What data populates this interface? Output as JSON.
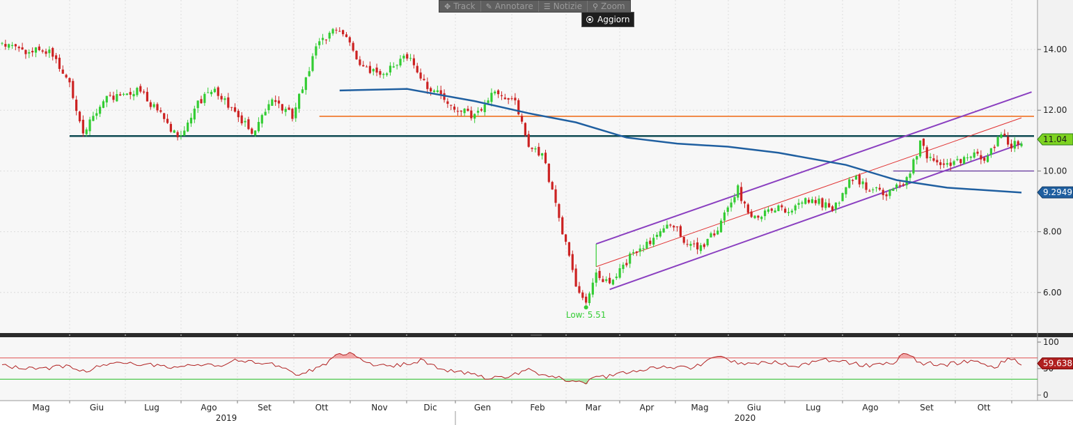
{
  "toolbar": {
    "items": [
      {
        "label": "Track",
        "icon": "crosshair-icon"
      },
      {
        "label": "Annotare",
        "icon": "pencil-icon"
      },
      {
        "label": "Notizie",
        "icon": "news-icon"
      },
      {
        "label": "Zoom",
        "icon": "magnifier-icon"
      }
    ],
    "update_label": "Aggiorn"
  },
  "colors": {
    "up": "#33cc33",
    "down": "#cc2222",
    "ma": "#1f5fa0",
    "channel": "#8a3fc0",
    "midline": "#e03030",
    "resistance": "#f07020",
    "support": "#0d4a52",
    "level10": "#6a3fa0",
    "rsi_line": "#b02020",
    "rsi_upper": "#e05050",
    "rsi_lower": "#22bb22"
  },
  "chart_data": [
    {
      "type": "candlestick",
      "title": "",
      "y_ticks": [
        "14.00",
        "12.00",
        "10.00",
        "8.00",
        "6.00"
      ],
      "ylim": [
        4.6,
        15.7
      ],
      "grid": true,
      "x_months": [
        "Mag",
        "Giu",
        "Lug",
        "Ago",
        "Set",
        "Ott",
        "Nov",
        "Dic",
        "Gen",
        "Feb",
        "Mar",
        "Apr",
        "Mag",
        "Giu",
        "Lug",
        "Ago",
        "Set",
        "Ott"
      ],
      "x_years": [
        "2019",
        "2020"
      ],
      "close_path": [
        [
          0,
          14.2
        ],
        [
          8,
          13.9
        ],
        [
          14,
          14.0
        ],
        [
          20,
          12.9
        ],
        [
          24,
          11.3
        ],
        [
          30,
          12.3
        ],
        [
          40,
          12.7
        ],
        [
          46,
          12.0
        ],
        [
          52,
          11.1
        ],
        [
          58,
          12.2
        ],
        [
          62,
          12.7
        ],
        [
          68,
          12.1
        ],
        [
          74,
          11.3
        ],
        [
          80,
          12.3
        ],
        [
          86,
          11.8
        ],
        [
          90,
          13.0
        ],
        [
          94,
          14.3
        ],
        [
          100,
          14.7
        ],
        [
          106,
          13.5
        ],
        [
          112,
          13.1
        ],
        [
          120,
          13.8
        ],
        [
          126,
          12.8
        ],
        [
          134,
          12.1
        ],
        [
          140,
          11.8
        ],
        [
          146,
          12.6
        ],
        [
          152,
          12.2
        ],
        [
          156,
          10.9
        ],
        [
          160,
          10.5
        ],
        [
          163,
          9.4
        ],
        [
          166,
          8.0
        ],
        [
          170,
          6.2
        ],
        [
          173,
          5.6
        ],
        [
          176,
          6.6
        ],
        [
          180,
          6.2
        ],
        [
          186,
          7.2
        ],
        [
          192,
          7.6
        ],
        [
          198,
          8.3
        ],
        [
          203,
          7.6
        ],
        [
          208,
          7.5
        ],
        [
          213,
          8.3
        ],
        [
          218,
          9.4
        ],
        [
          222,
          8.4
        ],
        [
          228,
          8.7
        ],
        [
          234,
          8.8
        ],
        [
          240,
          9.1
        ],
        [
          246,
          8.7
        ],
        [
          252,
          9.8
        ],
        [
          256,
          9.5
        ],
        [
          262,
          9.2
        ],
        [
          268,
          9.7
        ],
        [
          272,
          10.9
        ],
        [
          276,
          10.2
        ],
        [
          282,
          10.3
        ],
        [
          288,
          10.6
        ],
        [
          292,
          10.4
        ],
        [
          296,
          11.3
        ],
        [
          299,
          10.8
        ],
        [
          302,
          11.04
        ]
      ],
      "annotations": [
        {
          "text": "Low: 5.51",
          "x": 173,
          "y": 5.51
        }
      ],
      "last_price": "11.04",
      "moving_average": {
        "label": "9.2949",
        "points": [
          [
            100,
            12.65
          ],
          [
            120,
            12.7
          ],
          [
            140,
            12.3
          ],
          [
            156,
            11.9
          ],
          [
            170,
            11.6
          ],
          [
            185,
            11.1
          ],
          [
            200,
            10.9
          ],
          [
            215,
            10.8
          ],
          [
            230,
            10.6
          ],
          [
            250,
            10.2
          ],
          [
            265,
            9.7
          ],
          [
            280,
            9.45
          ],
          [
            302,
            9.29
          ]
        ]
      },
      "levels": [
        {
          "name": "support",
          "y": 11.15,
          "x": [
            20,
            302
          ]
        },
        {
          "name": "resistance",
          "y": 11.8,
          "x": [
            94,
            302
          ]
        },
        {
          "name": "level10",
          "y": 10.0,
          "x": [
            264,
            302
          ]
        }
      ],
      "channel": {
        "upper": [
          [
            176,
            7.6
          ],
          [
            305,
            12.6
          ]
        ],
        "lower": [
          [
            180,
            6.1
          ],
          [
            302,
            10.9
          ]
        ],
        "mid": [
          [
            176,
            6.85
          ],
          [
            302,
            11.75
          ]
        ]
      }
    },
    {
      "type": "line",
      "title": "",
      "y_ticks": [
        "100",
        "50",
        "0"
      ],
      "ylim": [
        0,
        100
      ],
      "upper_level": 70,
      "lower_level": 30,
      "last_value": "59.6386",
      "path": [
        [
          0,
          55
        ],
        [
          6,
          52
        ],
        [
          12,
          48
        ],
        [
          18,
          55
        ],
        [
          24,
          45
        ],
        [
          30,
          55
        ],
        [
          36,
          63
        ],
        [
          42,
          58
        ],
        [
          50,
          52
        ],
        [
          58,
          60
        ],
        [
          64,
          55
        ],
        [
          70,
          66
        ],
        [
          76,
          62
        ],
        [
          82,
          55
        ],
        [
          88,
          38
        ],
        [
          92,
          48
        ],
        [
          96,
          60
        ],
        [
          100,
          80
        ],
        [
          104,
          76
        ],
        [
          108,
          60
        ],
        [
          116,
          55
        ],
        [
          124,
          65
        ],
        [
          130,
          50
        ],
        [
          138,
          40
        ],
        [
          144,
          30
        ],
        [
          150,
          36
        ],
        [
          156,
          48
        ],
        [
          160,
          38
        ],
        [
          164,
          35
        ],
        [
          168,
          25
        ],
        [
          172,
          22
        ],
        [
          176,
          32
        ],
        [
          182,
          38
        ],
        [
          190,
          48
        ],
        [
          196,
          55
        ],
        [
          204,
          50
        ],
        [
          212,
          72
        ],
        [
          220,
          58
        ],
        [
          228,
          62
        ],
        [
          236,
          55
        ],
        [
          244,
          66
        ],
        [
          252,
          60
        ],
        [
          258,
          55
        ],
        [
          264,
          62
        ],
        [
          268,
          80
        ],
        [
          272,
          60
        ],
        [
          280,
          58
        ],
        [
          288,
          65
        ],
        [
          294,
          52
        ],
        [
          298,
          70
        ],
        [
          302,
          59.64
        ]
      ]
    }
  ]
}
